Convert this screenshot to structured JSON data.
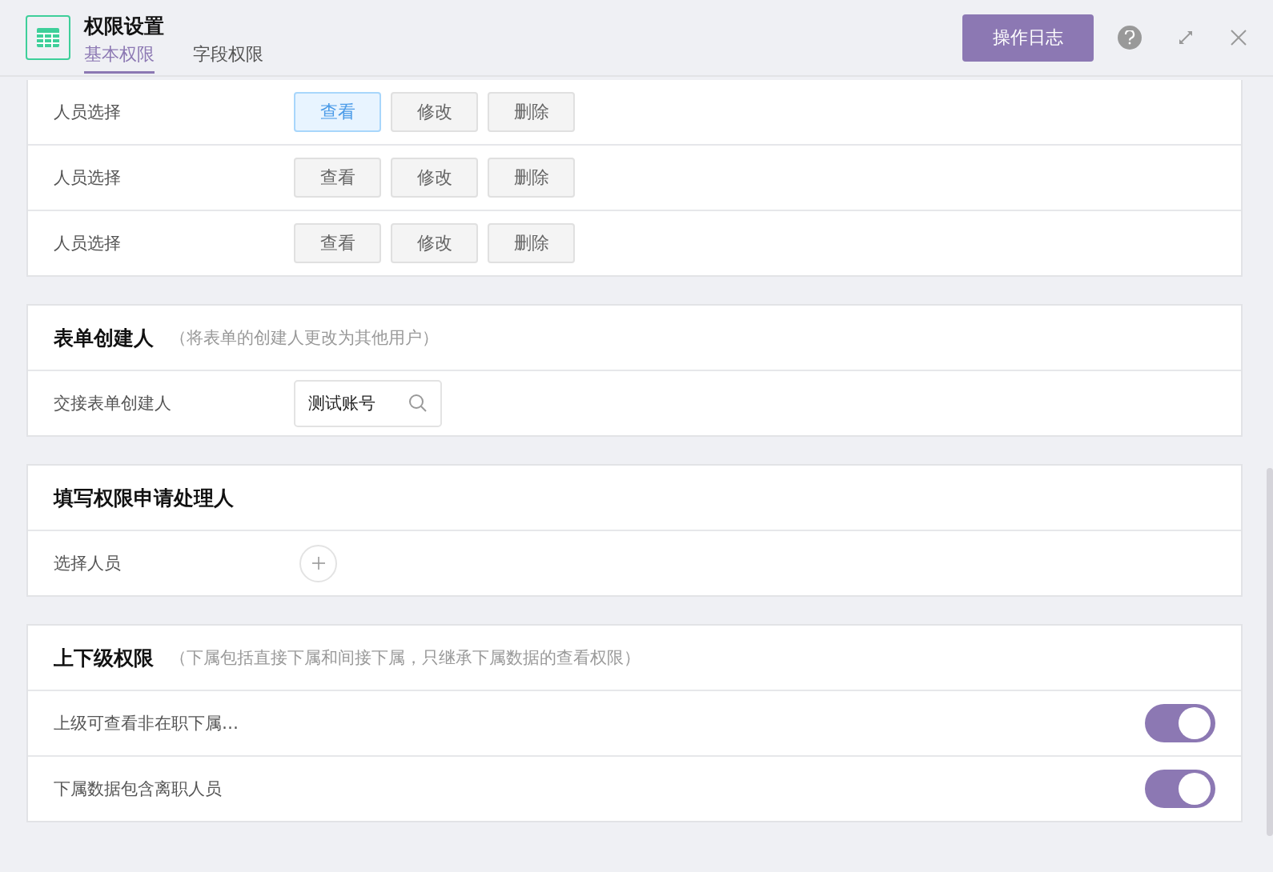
{
  "header": {
    "title": "权限设置",
    "tabs": [
      {
        "label": "基本权限",
        "selected": true
      },
      {
        "label": "字段权限",
        "selected": false
      }
    ],
    "log_button": "操作日志"
  },
  "sections": [
    {
      "rows": [
        {
          "kind": "buttons",
          "label": "人员选择",
          "buttons": [
            {
              "label": "查看",
              "selected": true
            },
            {
              "label": "修改",
              "selected": false
            },
            {
              "label": "删除",
              "selected": false
            }
          ]
        },
        {
          "kind": "buttons",
          "label": "人员选择",
          "buttons": [
            {
              "label": "查看",
              "selected": false
            },
            {
              "label": "修改",
              "selected": false
            },
            {
              "label": "删除",
              "selected": false
            }
          ]
        },
        {
          "kind": "buttons",
          "label": "人员选择",
          "buttons": [
            {
              "label": "查看",
              "selected": false
            },
            {
              "label": "修改",
              "selected": false
            },
            {
              "label": "删除",
              "selected": false
            }
          ]
        }
      ]
    },
    {
      "title": "表单创建人",
      "note": "（将表单的创建人更改为其他用户）",
      "rows": [
        {
          "kind": "search",
          "label": "交接表单创建人",
          "value": "测试账号"
        }
      ]
    },
    {
      "title": "填写权限申请处理人",
      "rows": [
        {
          "kind": "add",
          "label": "选择人员"
        }
      ]
    },
    {
      "title": "上下级权限",
      "note": "（下属包括直接下属和间接下属，只继承下属数据的查看权限）",
      "rows": [
        {
          "kind": "toggle",
          "label": "上级可查看非在职下属…",
          "on": true
        },
        {
          "kind": "toggle",
          "label": "下属数据包含离职人员",
          "on": true
        }
      ]
    }
  ]
}
